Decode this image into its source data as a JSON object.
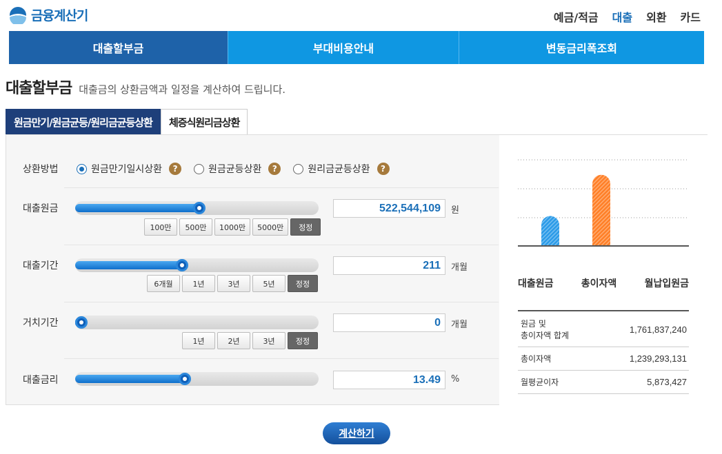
{
  "brand": {
    "name": "금융계산기",
    "logo_icon": "half-circle-logo-icon"
  },
  "top_nav": [
    {
      "label": "예금/적금",
      "active": false
    },
    {
      "label": "대출",
      "active": true
    },
    {
      "label": "외환",
      "active": false
    },
    {
      "label": "카드",
      "active": false
    }
  ],
  "main_tabs": [
    {
      "label": "대출할부금",
      "active": true
    },
    {
      "label": "부대비용안내",
      "active": false
    },
    {
      "label": "변동금리폭조회",
      "active": false
    }
  ],
  "page": {
    "title": "대출할부금",
    "description": "대출금의 상환금액과 일정을 계산하여 드립니다."
  },
  "sub_tabs": [
    {
      "label": "원금만기/원금균등/원리금균등상환",
      "active": true
    },
    {
      "label": "체증식원리금상환",
      "active": false
    }
  ],
  "repayment": {
    "label": "상환방법",
    "options": [
      {
        "label": "원금만기일시상환",
        "checked": true
      },
      {
        "label": "원금균등상환",
        "checked": false
      },
      {
        "label": "원리금균등상환",
        "checked": false
      }
    ],
    "help_glyph": "?"
  },
  "loan_amount": {
    "label": "대출원금",
    "value": "522,544,109",
    "unit": "원",
    "slider_fraction": 0.51,
    "buttons": [
      "100만",
      "500만",
      "1000만",
      "5000만"
    ],
    "reset_label": "정정"
  },
  "loan_period": {
    "label": "대출기간",
    "value": "211",
    "unit": "개월",
    "slider_fraction": 0.44,
    "buttons": [
      "6개월",
      "1년",
      "3년",
      "5년"
    ],
    "reset_label": "정정"
  },
  "grace_period": {
    "label": "거치기간",
    "value": "0",
    "unit": "개월",
    "slider_fraction": 0.02,
    "buttons": [
      "1년",
      "2년",
      "3년"
    ],
    "reset_label": "정정"
  },
  "interest_rate": {
    "label": "대출금리",
    "value": "13.49",
    "unit": "%",
    "slider_fraction": 0.45
  },
  "chart_data": {
    "type": "bar",
    "categories": [
      "대출원금",
      "총이자액",
      "월납입원금"
    ],
    "values": [
      522544109,
      1239293131,
      0
    ],
    "colors": [
      "#2b9be8",
      "#ff7f27",
      "#cccccc"
    ],
    "ylim": [
      0,
      1500000000
    ],
    "grid": true
  },
  "summary": [
    {
      "label_line1": "원금 및",
      "label_line2": "총이자액 합계",
      "value": "1,761,837,240"
    },
    {
      "label_line1": "총이자액",
      "label_line2": "",
      "value": "1,239,293,131"
    },
    {
      "label_line1": "월평균이자",
      "label_line2": "",
      "value": "5,873,427"
    }
  ],
  "calc_button": {
    "label": "계산하기"
  }
}
